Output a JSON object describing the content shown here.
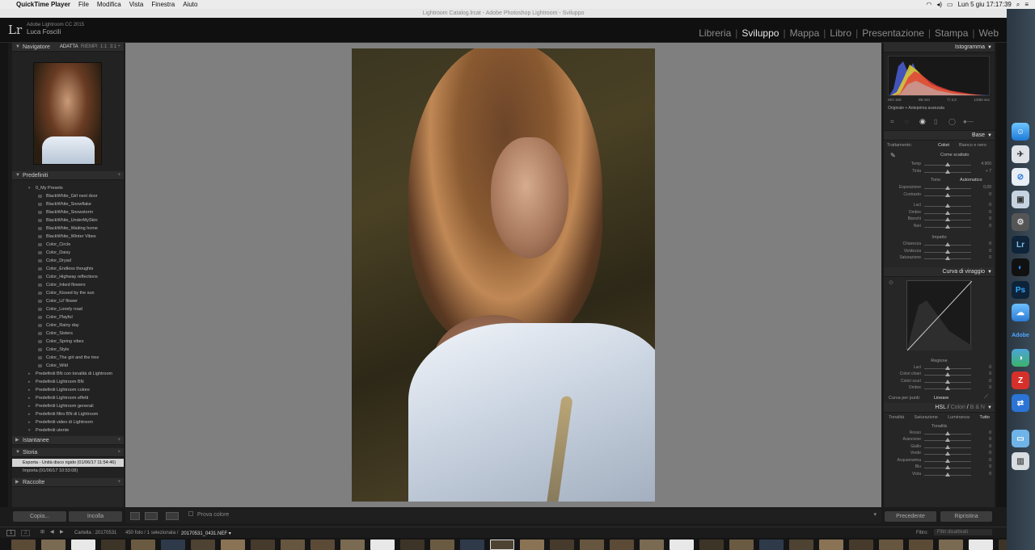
{
  "mac": {
    "app": "QuickTime Player",
    "menu": [
      "File",
      "Modifica",
      "Vista",
      "Finestra",
      "Aiuto"
    ],
    "clock": "Lun 5 giu  17:17:39"
  },
  "window_title": "Lightroom Catalog.lrcat - Adobe Photoshop Lightroom - Sviluppo",
  "lr": {
    "product": "Adobe Lightroom CC 2015",
    "user": "Luca Foscili"
  },
  "modules": [
    "Libreria",
    "Sviluppo",
    "Mappa",
    "Libro",
    "Presentazione",
    "Stampa",
    "Web"
  ],
  "left": {
    "navigator": {
      "title": "Navigatore",
      "fit": "ADATTA",
      "fill": "RIEMPI",
      "one": "1:1",
      "ratio": "3:1 ÷"
    },
    "presets": {
      "title": "Predefiniti",
      "folder": "0_My Presets",
      "items": [
        "BlackWhite_Girl next door",
        "BlackWhite_Snowflake",
        "BlackWhite_Snowstorm",
        "BlackWhite_UnderMySkin",
        "BlackWhite_Waiting home",
        "BlackWhite_Winter Vibes",
        "Color_Circle",
        "Color_Daisy",
        "Color_Dryad",
        "Color_Endless thoughts",
        "Color_Highway reflections",
        "Color_Inked flowers",
        "Color_Kissed by the sun",
        "Color_Lil' flower",
        "Color_Lonely road",
        "Color_Playful",
        "Color_Rainy day",
        "Color_Sisters",
        "Color_Spring vibes",
        "Color_Style",
        "Color_The girl and the tree",
        "Color_Wild"
      ],
      "folders": [
        "Predefiniti BN con tonalità di Lightroom",
        "Predefiniti Lightroom BN",
        "Predefiniti Lightroom colore",
        "Predefiniti Lightroom effetti",
        "Predefiniti Lightroom generali",
        "Predefiniti filtro BN di Lightroom",
        "Predefiniti video di Lightroom"
      ],
      "user": "Predefiniti utente"
    },
    "snapshots": "Istantanee",
    "history": {
      "title": "Storia",
      "items": [
        "Esporta - Unità disco rigido (01/06/17 11:54:46)",
        "Importa (01/06/17 10:53:08)"
      ]
    },
    "collections": "Raccolte",
    "copy": "Copia...",
    "paste": "Incolla"
  },
  "toolbar": {
    "softproof": "Prova colore"
  },
  "right": {
    "histogram": {
      "title": "Istogramma",
      "iso": "ISO 100",
      "focal": "85 mm",
      "aperture": "f / 2,0",
      "shutter": "1/250 sec",
      "original": "Originale + Anteprima avanzata"
    },
    "basic": {
      "title": "Base",
      "treatment": "Trattamento:",
      "color": "Colori",
      "bw": "Bianco e nero",
      "wb": "Come scattato",
      "wb_sliders": [
        {
          "label": "Temp",
          "value": "4.900"
        },
        {
          "label": "Tinta",
          "value": "+ 7"
        }
      ],
      "tone": "Tono",
      "auto": "Automatico",
      "tone_sliders": [
        {
          "label": "Esposizione",
          "value": "0,00"
        },
        {
          "label": "Contrasto",
          "value": "0"
        }
      ],
      "light_sliders": [
        {
          "label": "Luci",
          "value": "0"
        },
        {
          "label": "Ombre",
          "value": "0"
        },
        {
          "label": "Bianchi",
          "value": "0"
        },
        {
          "label": "Neri",
          "value": "0"
        }
      ],
      "presence": "Impatto",
      "presence_sliders": [
        {
          "label": "Chiarezza",
          "value": "0"
        },
        {
          "label": "Vividezza",
          "value": "0"
        },
        {
          "label": "Saturazione",
          "value": "0"
        }
      ]
    },
    "curve": {
      "title": "Curva di viraggio",
      "region": "Regione",
      "sliders": [
        {
          "label": "Luci",
          "value": "0"
        },
        {
          "label": "Colori chiari",
          "value": "0"
        },
        {
          "label": "Colori scuri",
          "value": "0"
        },
        {
          "label": "Ombre",
          "value": "0"
        }
      ],
      "points_label": "Curva per punti:",
      "points_value": "Lineare"
    },
    "hsl": {
      "title_hsl": "HSL",
      "title_color": "Colori",
      "title_bw": "B & N",
      "tabs": [
        "Tonalità",
        "Saturazione",
        "Luminanza",
        "Tutto"
      ],
      "section": "Tonalità",
      "sliders": [
        {
          "label": "Rosso",
          "value": "0"
        },
        {
          "label": "Arancione",
          "value": "0"
        },
        {
          "label": "Giallo",
          "value": "0"
        },
        {
          "label": "Verde",
          "value": "0"
        },
        {
          "label": "Acquamarina",
          "value": "0"
        },
        {
          "label": "Blu",
          "value": "0"
        },
        {
          "label": "Viola",
          "value": "0"
        }
      ]
    },
    "prev": "Precedente",
    "reset": "Ripristina"
  },
  "filmstrip": {
    "page1": "1",
    "page2": "2",
    "folder": "Cartella : 20170531",
    "count": "450 foto / 1 selezionata /",
    "file": "20170531_0431.NEF ▾",
    "filter_label": "Filtro:",
    "filter_value": "Filtri disattivati"
  }
}
